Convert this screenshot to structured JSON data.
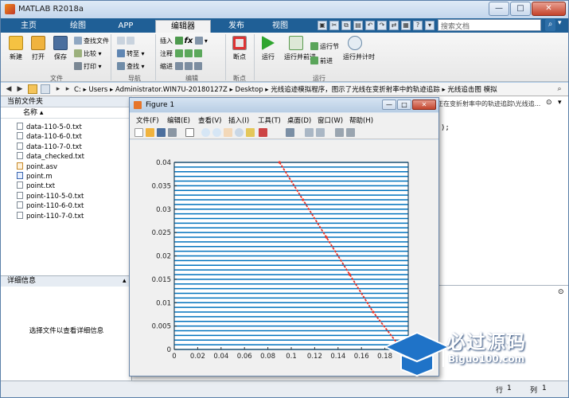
{
  "window": {
    "title": "MATLAB R2018a",
    "min_glyph": "—",
    "max_glyph": "□",
    "close_glyph": "✕"
  },
  "tabs": [
    {
      "label": "主页",
      "active": false
    },
    {
      "label": "绘图",
      "active": false
    },
    {
      "label": "APP",
      "active": false
    },
    {
      "label": "编辑器",
      "active": true
    },
    {
      "label": "发布",
      "active": false
    },
    {
      "label": "视图",
      "active": false
    }
  ],
  "search": {
    "placeholder": "搜索文档"
  },
  "ribbon": {
    "file": {
      "new": "新建",
      "open": "打开",
      "save": "保存",
      "find_files": "查找文件",
      "compare": "比较",
      "print": "打印",
      "group": "文件"
    },
    "navigate": {
      "goto": "转至",
      "find": "查找",
      "group": "导航"
    },
    "edit": {
      "insert": "插入",
      "comment": "注释",
      "indent": "缩进",
      "fx": "fx",
      "group": "编辑"
    },
    "breakpoints": {
      "breakpoints": "断点",
      "group": "断点"
    },
    "run": {
      "run": "运行",
      "run_advance": "运行并前进",
      "run_section": "运行节",
      "advance": "前进",
      "run_time": "运行并计时",
      "group": "运行"
    }
  },
  "address": {
    "path": "C: ▸ Users ▸ Administrator.WIN7U-20180127Z ▸ Desktop ▸ 光线追迹模拟程序，图示了光线在变折射率中的轨迹追踪 ▸ 光线追击图  模拟"
  },
  "current_folder": {
    "title": "当前文件夹",
    "column": "名称 ▴",
    "files": [
      {
        "name": "data-110-5-0.txt",
        "kind": "txt"
      },
      {
        "name": "data-110-6-0.txt",
        "kind": "txt"
      },
      {
        "name": "data-110-7-0.txt",
        "kind": "txt"
      },
      {
        "name": "data_checked.txt",
        "kind": "txt"
      },
      {
        "name": "point.asv",
        "kind": "asv"
      },
      {
        "name": "point.m",
        "kind": "m"
      },
      {
        "name": "point.txt",
        "kind": "txt"
      },
      {
        "name": "point-110-5-0.txt",
        "kind": "txt"
      },
      {
        "name": "point-110-6-0.txt",
        "kind": "txt"
      },
      {
        "name": "point-110-7-0.txt",
        "kind": "txt"
      }
    ]
  },
  "details": {
    "title": "详细信息",
    "message": "选择文件以查看详细信息"
  },
  "editor": {
    "tab_fragment": "正在变折射率中的轨迹追踪\\光线追...",
    "code_fragment": ");"
  },
  "status": {
    "row_label": "行",
    "row": "1",
    "col_label": "列",
    "col": "1"
  },
  "figure": {
    "title": "Figure 1",
    "menu": [
      "文件(F)",
      "编辑(E)",
      "查看(V)",
      "插入(I)",
      "工具(T)",
      "桌面(D)",
      "窗口(W)",
      "帮助(H)"
    ]
  },
  "watermark": {
    "text": "必过源码",
    "sub": "Biguo100.com"
  },
  "chart_data": {
    "type": "line",
    "title": "",
    "xlabel": "",
    "ylabel": "",
    "xlim": [
      0,
      0.2
    ],
    "ylim": [
      0,
      0.04
    ],
    "xticks": [
      0,
      0.02,
      0.04,
      0.06,
      0.08,
      0.1,
      0.12,
      0.14,
      0.16,
      0.18,
      0.2
    ],
    "xtick_labels": [
      "0",
      "0.02",
      "0.04",
      "0.06",
      "0.08",
      "0.1",
      "0.12",
      "0.14",
      "0.16",
      "0.18",
      "0.2"
    ],
    "yticks": [
      0,
      0.005,
      0.01,
      0.015,
      0.02,
      0.025,
      0.03,
      0.035,
      0.04
    ],
    "ytick_labels": [
      "0",
      "0.005",
      "0.01",
      "0.015",
      "0.02",
      "0.025",
      "0.03",
      "0.035",
      "0.04"
    ],
    "layer_line_count": 41,
    "layer_color": "#0072bd",
    "ray": {
      "color": "#e8352a",
      "x": [
        0.09,
        0.11,
        0.13,
        0.15,
        0.17,
        0.19
      ],
      "y": [
        0.04,
        0.032,
        0.024,
        0.016,
        0.008,
        0.0015
      ]
    }
  }
}
